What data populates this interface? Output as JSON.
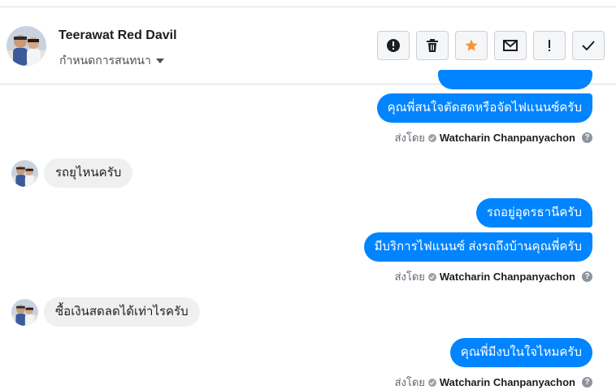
{
  "header": {
    "contact_name": "Teerawat Red Davil",
    "conversation_setting_label": "กำหนดการสนทนา",
    "actions": [
      {
        "name": "mark-spam",
        "icon": "exclamation-circle-icon"
      },
      {
        "name": "delete",
        "icon": "trash-icon"
      },
      {
        "name": "star",
        "icon": "star-icon",
        "color": "#f7923b"
      },
      {
        "name": "mark-unread",
        "icon": "envelope-icon"
      },
      {
        "name": "flag-important",
        "icon": "exclamation-icon"
      },
      {
        "name": "mark-done",
        "icon": "check-icon"
      }
    ]
  },
  "colors": {
    "outgoing_bubble": "#0084ff",
    "incoming_bubble": "#f0f0f0",
    "star": "#f7923b"
  },
  "messages": [
    {
      "direction": "out",
      "text": "คุณพี่สนใจตัดสดหรือจัดไฟแนนซ์ครับ"
    },
    {
      "direction": "in",
      "text": "รถยุไหนครับ"
    },
    {
      "direction": "out",
      "text": "รถอยู่อุดรธานีครับ"
    },
    {
      "direction": "out",
      "text": "มีบริการไฟแนนซ์ ส่งรถถึงบ้านคุณพี่ครับ"
    },
    {
      "direction": "in",
      "text": "ซื้อเงินสดลดได้เท่าไรครับ"
    },
    {
      "direction": "out",
      "text": "คุณพี่มีงบในใจไหมครับ"
    }
  ],
  "sent_by": {
    "prefix": "ส่งโดย",
    "agent": "Watcharin Chanpanyachon",
    "help": "?"
  }
}
